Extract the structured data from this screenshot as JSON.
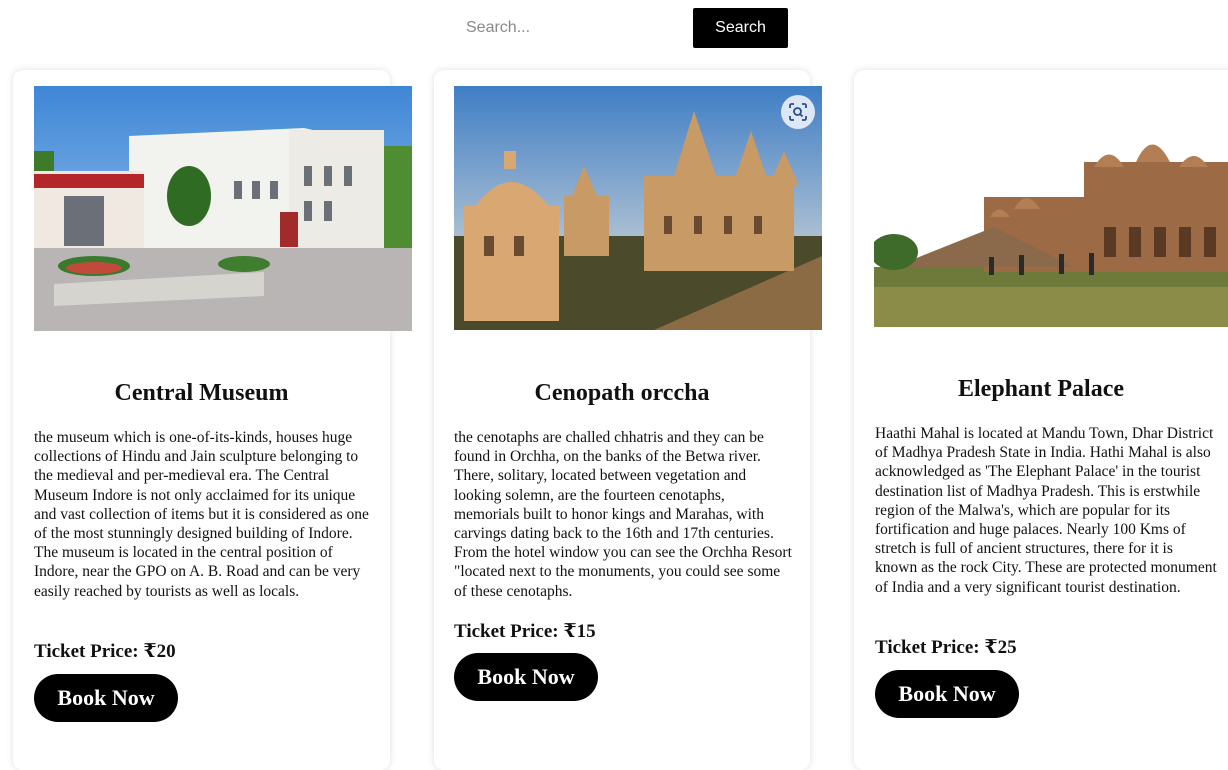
{
  "search": {
    "placeholder": "Search...",
    "button_label": "Search"
  },
  "cards": [
    {
      "title": "Central Museum",
      "description": "the museum which is one-of-its-kinds, houses huge collections of Hindu and Jain sculpture belonging to the medieval and per-medieval era. The Central Museum Indore is not only acclaimed for its unique and vast collection of items but it is considered as one of the most stunningly designed building of Indore. The museum is located in the central position of Indore, near the GPO on A. B. Road and can be very easily reached by tourists as well as locals.",
      "price": "Ticket Price: ₹20",
      "button_label": "Book Now"
    },
    {
      "title": "Cenopath orccha",
      "description": "the cenotaphs are challed chhatris and they can be found in Orchha, on the banks of the Betwa river. There, solitary, located between vegetation and looking solemn, are the fourteen cenotaphs, memorials built to honor kings and Marahas, with carvings dating back to the 16th and 17th centuries. From the hotel window you can see the Orchha Resort \"located next to the monuments, you could see some of these cenotaphs.",
      "price": "Ticket Price: ₹15",
      "button_label": "Book Now"
    },
    {
      "title": "Elephant Palace",
      "description": "Haathi Mahal is located at Mandu Town, Dhar District of Madhya Pradesh State in India. Hathi Mahal is also acknowledged as 'The Elephant Palace' in the tourist destination list of Madhya Pradesh. This is erstwhile region of the Malwa's, which are popular for its fortification and huge palaces. Nearly 100 Kms of stretch is full of ancient structures, there for it is known as the rock City. These are protected monument of India and a very significant tourist destination.",
      "price": "Ticket Price: ₹25",
      "button_label": "Book Now"
    }
  ],
  "icons": {
    "lens": "lens-search-icon"
  },
  "colors": {
    "button_bg": "#000000",
    "button_text": "#ffffff",
    "card_bg": "#ffffff"
  }
}
